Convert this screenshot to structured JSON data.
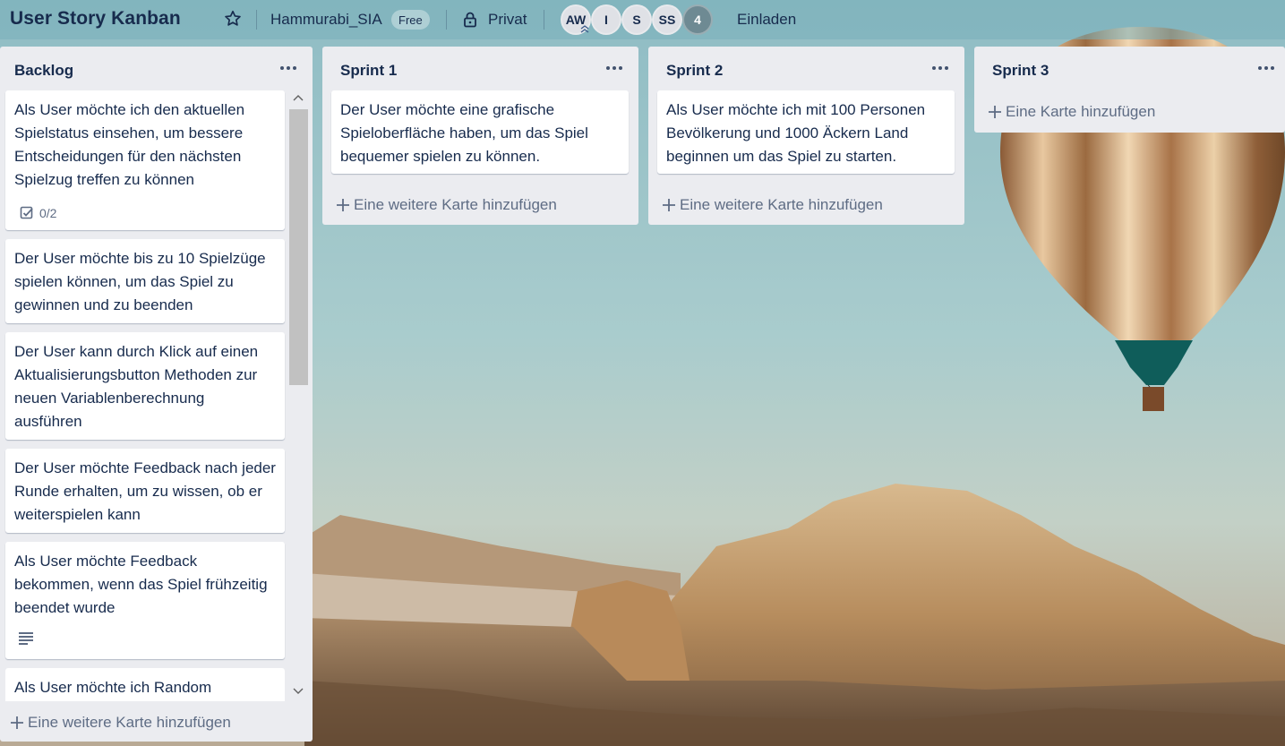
{
  "header": {
    "board_title": "User Story Kanban",
    "workspace_name": "Hammurabi_SIA",
    "plan_badge": "Free",
    "visibility": "Privat",
    "members": [
      "AW",
      "I",
      "S",
      "SS"
    ],
    "member_overflow": "4",
    "invite_label": "Einladen"
  },
  "lists": [
    {
      "title": "Backlog",
      "cards": [
        {
          "text": "Als User möchte ich den aktuellen Spielstatus einsehen, um bessere Entscheidungen für den nächsten Spielzug treffen zu können",
          "checklist": "0/2"
        },
        {
          "text": "Der User möchte bis zu 10 Spielzüge spielen können, um das Spiel zu gewinnen und zu beenden"
        },
        {
          "text": "Der User kann durch Klick auf einen Aktualisierungsbutton Methoden zur neuen Variablenberechnung ausführen"
        },
        {
          "text": "Der User möchte Feedback nach jeder Runde erhalten, um zu wissen, ob er weiterspielen kann"
        },
        {
          "text": "Als User möchte Feedback bekommen, wenn das Spiel frühzeitig beendet wurde",
          "has_description": true
        },
        {
          "text": "Als User möchte ich Random"
        }
      ],
      "add_label": "Eine weitere Karte hinzufügen"
    },
    {
      "title": "Sprint 1",
      "cards": [
        {
          "text": "Der User möchte eine grafische Spieloberfläche haben, um das Spiel bequemer spielen zu können."
        }
      ],
      "add_label": "Eine weitere Karte hinzufügen"
    },
    {
      "title": "Sprint 2",
      "cards": [
        {
          "text": "Als User möchte ich mit 100 Personen Bevölkerung und 1000 Äckern Land beginnen um das Spiel zu starten."
        }
      ],
      "add_label": "Eine weitere Karte hinzufügen"
    },
    {
      "title": "Sprint 3",
      "cards": [],
      "add_label": "Eine Karte hinzufügen"
    }
  ],
  "icons": {
    "star": "star-icon",
    "lock": "lock-icon",
    "menu": "ellipsis-icon",
    "checklist": "checklist-icon",
    "description": "description-icon",
    "add": "plus-icon"
  },
  "colors": {
    "list_bg": "#ebecf0",
    "card_bg": "#ffffff",
    "text": "#172b4d",
    "muted": "#5e6c84"
  }
}
